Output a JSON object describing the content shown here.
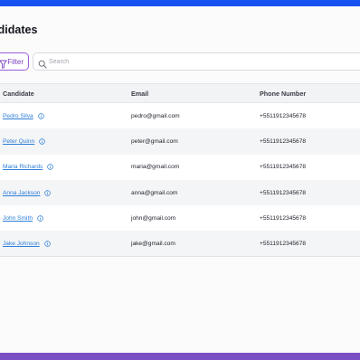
{
  "page": {
    "title": "ndidates"
  },
  "toolbar": {
    "filter_label": "Filter",
    "search_placeholder": "Search",
    "search_value": ""
  },
  "table": {
    "columns": [
      "Candidate",
      "Email",
      "Phone Number"
    ],
    "rows": [
      {
        "name": "Pedro Silva",
        "email": "pedro@gmail.com",
        "phone": "+5511912345678"
      },
      {
        "name": "Peter Quinn",
        "email": "peter@gmail.com",
        "phone": "+5511912345678"
      },
      {
        "name": "Maria Richards",
        "email": "maria@gmail.com",
        "phone": "+5511912345678"
      },
      {
        "name": "Anna Jackson",
        "email": "anna@gmail.com",
        "phone": "+5511912345678"
      },
      {
        "name": "John Smith",
        "email": "john@gmail.com",
        "phone": "+5511912345678"
      },
      {
        "name": "Jake Johnson",
        "email": "jake@gmail.com",
        "phone": "+5511912345678"
      }
    ]
  },
  "icons": {
    "filter": "filter-icon",
    "search": "search-icon",
    "info": "info-icon"
  },
  "colors": {
    "top_bar": "#1652f0",
    "bottom_bar": "#7b4fc4",
    "filter_accent": "#9b5bd6",
    "link": "#2d7fd8"
  }
}
